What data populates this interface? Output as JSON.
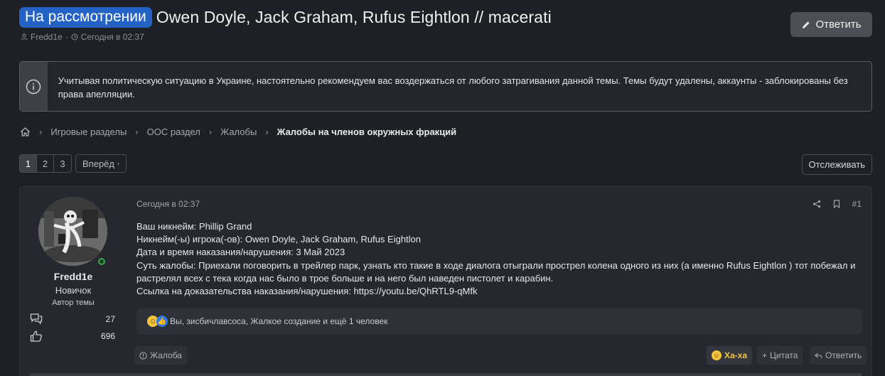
{
  "thread": {
    "prefix": "На рассмотрении",
    "title": "Owen Doyle, Jack Graham, Rufus Eightlon // macerati",
    "author": "Fredd1e",
    "separator": "·",
    "date": "Сегодня в 02:37",
    "reply_label": "Ответить"
  },
  "notice": {
    "text": "Учитывая политическую ситуацию в Украине, настоятельно рекомендуем вас воздержаться от любого затрагивания данной темы. Темы будут удалены, аккаунты - заблокированы без права апелляции."
  },
  "breadcrumb": {
    "items": [
      "Игровые разделы",
      "ООС раздел",
      "Жалобы",
      "Жалобы на членов окружных фракций"
    ]
  },
  "pagination": {
    "pages": [
      "1",
      "2",
      "3"
    ],
    "current": "1",
    "next_label": "Вперёд",
    "watch_label": "Отслеживать"
  },
  "post": {
    "author_name": "Fredd1e",
    "author_title": "Новичок",
    "author_badge": "Автор темы",
    "messages_count": "27",
    "reactions_count": "696",
    "date": "Сегодня в 02:37",
    "number": "#1",
    "body": [
      "Ваш никнейм: Phillip Grand",
      "Никнейм(-ы) игрока(-ов): Owen Doyle, Jack Graham, Rufus Eightlon",
      "Дата и время наказания/нарушения: 3 Май 2023",
      "Суть жалобы: Приехали поговорить в трейлер парк, узнать кто такие в ходе диалога отыграли прострел колена одного из них (а именно Rufus Eightlon ) тот побежал и растрелял всех с тека когда нас было в трое больше и на него был наведен пистолет и карабин.",
      "Ссылка на доказательства наказания/нарушения: https://youtu.be/QhRTL9-qMfk"
    ],
    "reactions_text": "Вы, зисбичлавсоса, Жалкое создание и ещё 1 человек",
    "report_label": "Жалоба",
    "haha_label": "Ха-ха",
    "quote_label": "Цитата",
    "reply_label": "Ответить"
  },
  "colors": {
    "background": "#1e2026",
    "prefix": "#2463c5",
    "haha": "#f5c33b",
    "online": "#3aa64b"
  }
}
